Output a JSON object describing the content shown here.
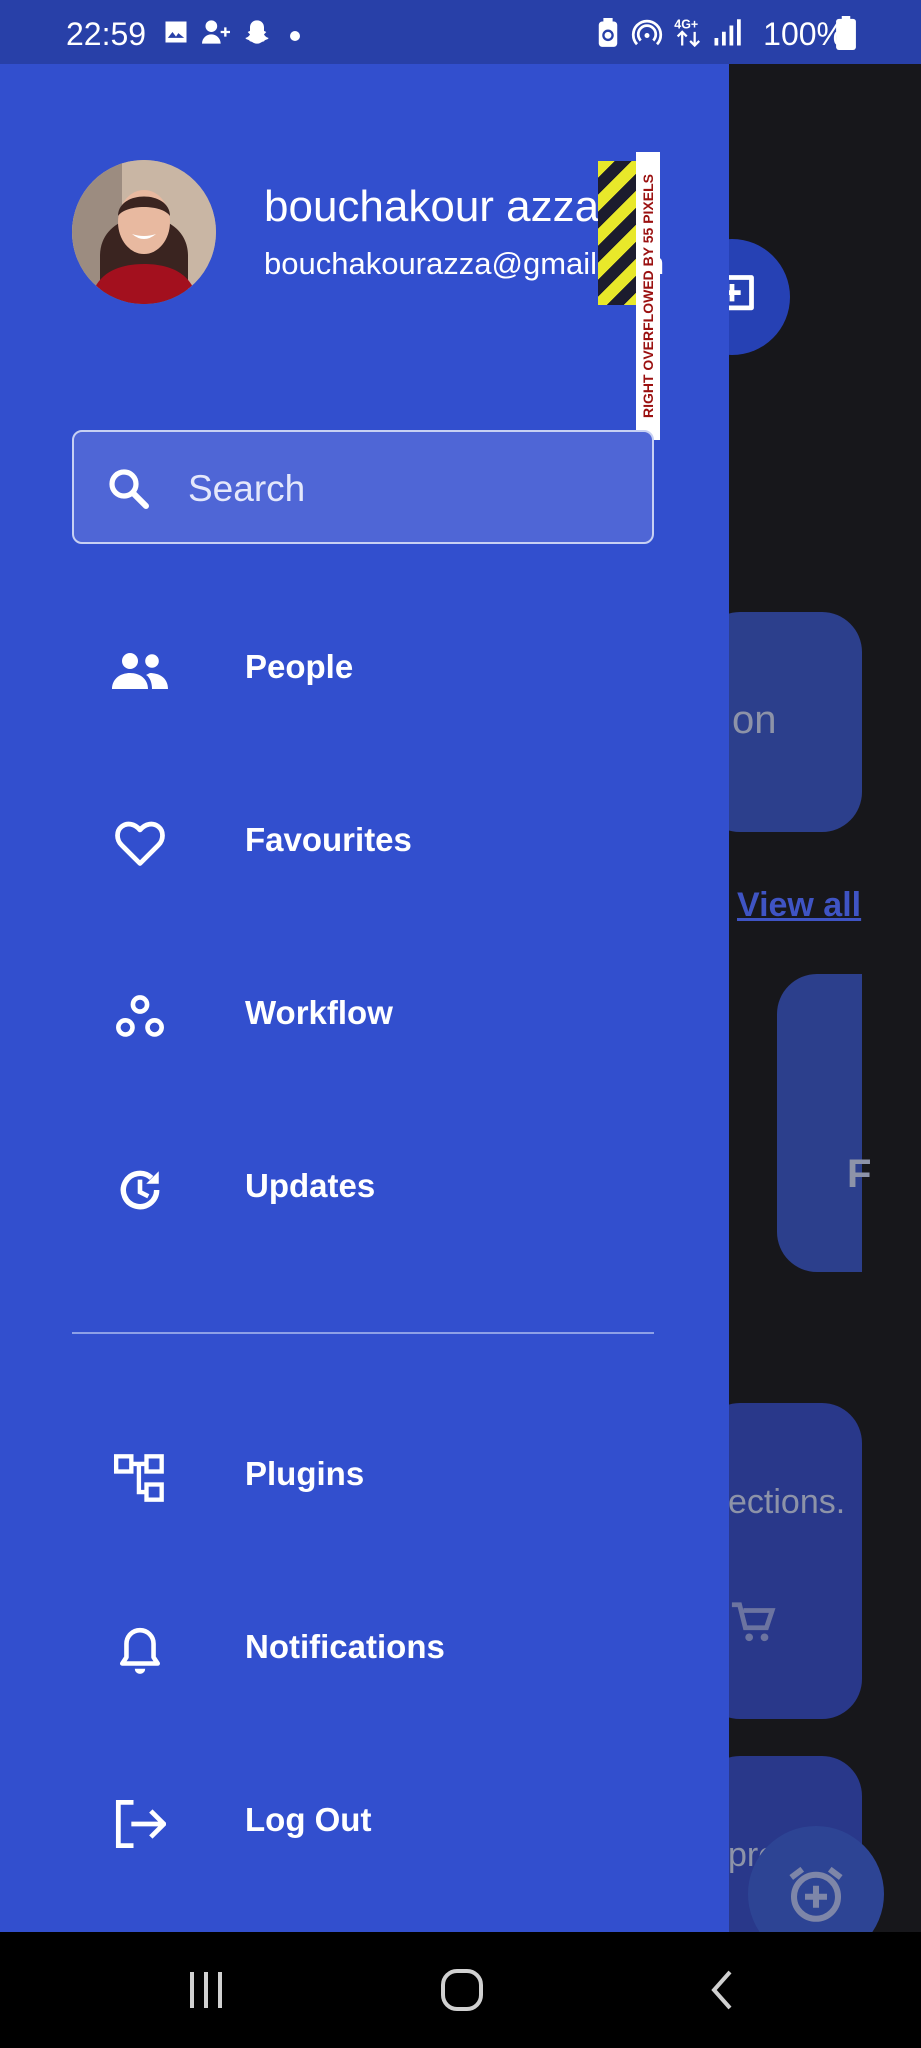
{
  "status_bar": {
    "time": "22:59",
    "battery": "100%",
    "network": "4G+"
  },
  "background": {
    "card1_text": "on",
    "view_all": "View all",
    "card2_text": "F",
    "card3_text": "ections.",
    "card4_text": "pre"
  },
  "drawer": {
    "user_name": "bouchakour azza",
    "user_email": "bouchakourazza@gmail.com",
    "overflow_warning": "RIGHT OVERFLOWED BY 55 PIXELS",
    "search_placeholder": "Search",
    "menu": [
      {
        "label": "People",
        "icon": "people-icon"
      },
      {
        "label": "Favourites",
        "icon": "heart-icon"
      },
      {
        "label": "Workflow",
        "icon": "workflow-icon"
      },
      {
        "label": "Updates",
        "icon": "updates-icon"
      },
      {
        "label": "Plugins",
        "icon": "plugins-icon"
      },
      {
        "label": "Notifications",
        "icon": "bell-icon"
      },
      {
        "label": "Log Out",
        "icon": "logout-icon"
      }
    ]
  },
  "colors": {
    "drawer": "#324fce",
    "status_bar": "#2840a8",
    "accent": "#2641b4"
  }
}
